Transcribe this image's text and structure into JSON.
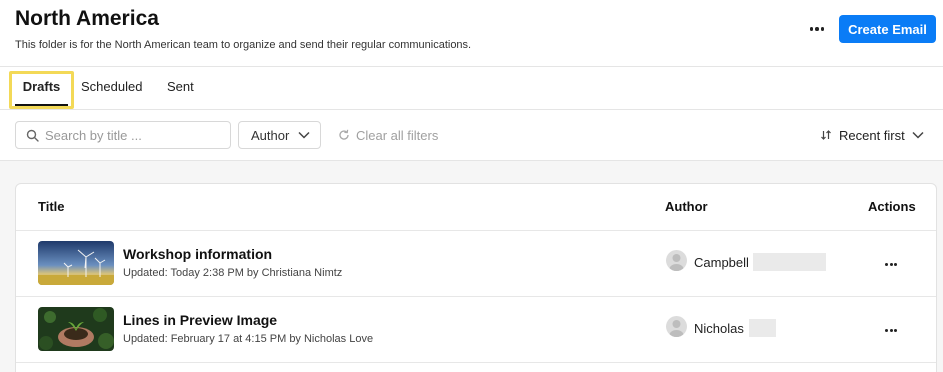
{
  "header": {
    "title": "North America",
    "description": "This folder is for the North American team to organize and send their regular communications.",
    "create_button": "Create Email",
    "more_icon": "more-horizontal-icon"
  },
  "tabs": [
    {
      "label": "Drafts",
      "active": true
    },
    {
      "label": "Scheduled",
      "active": false
    },
    {
      "label": "Sent",
      "active": false
    }
  ],
  "filters": {
    "search_placeholder": "Search by title ...",
    "author_label": "Author",
    "clear_label": "Clear all filters",
    "sort_label": "Recent first"
  },
  "table": {
    "columns": [
      "Title",
      "Author",
      "Actions"
    ],
    "rows": [
      {
        "title": "Workshop information",
        "meta": "Updated: Today 2:38 PM by Christiana Nimtz",
        "author": "Campbell",
        "thumbnail": "wind-turbines-image"
      },
      {
        "title": "Lines in Preview Image",
        "meta": "Updated: February 17 at 4:15 PM by Nicholas Love",
        "author": "Nicholas",
        "thumbnail": "hands-holding-soil-image"
      }
    ]
  },
  "colors": {
    "accent": "#0a7cf6",
    "highlight": "#f3d957"
  }
}
